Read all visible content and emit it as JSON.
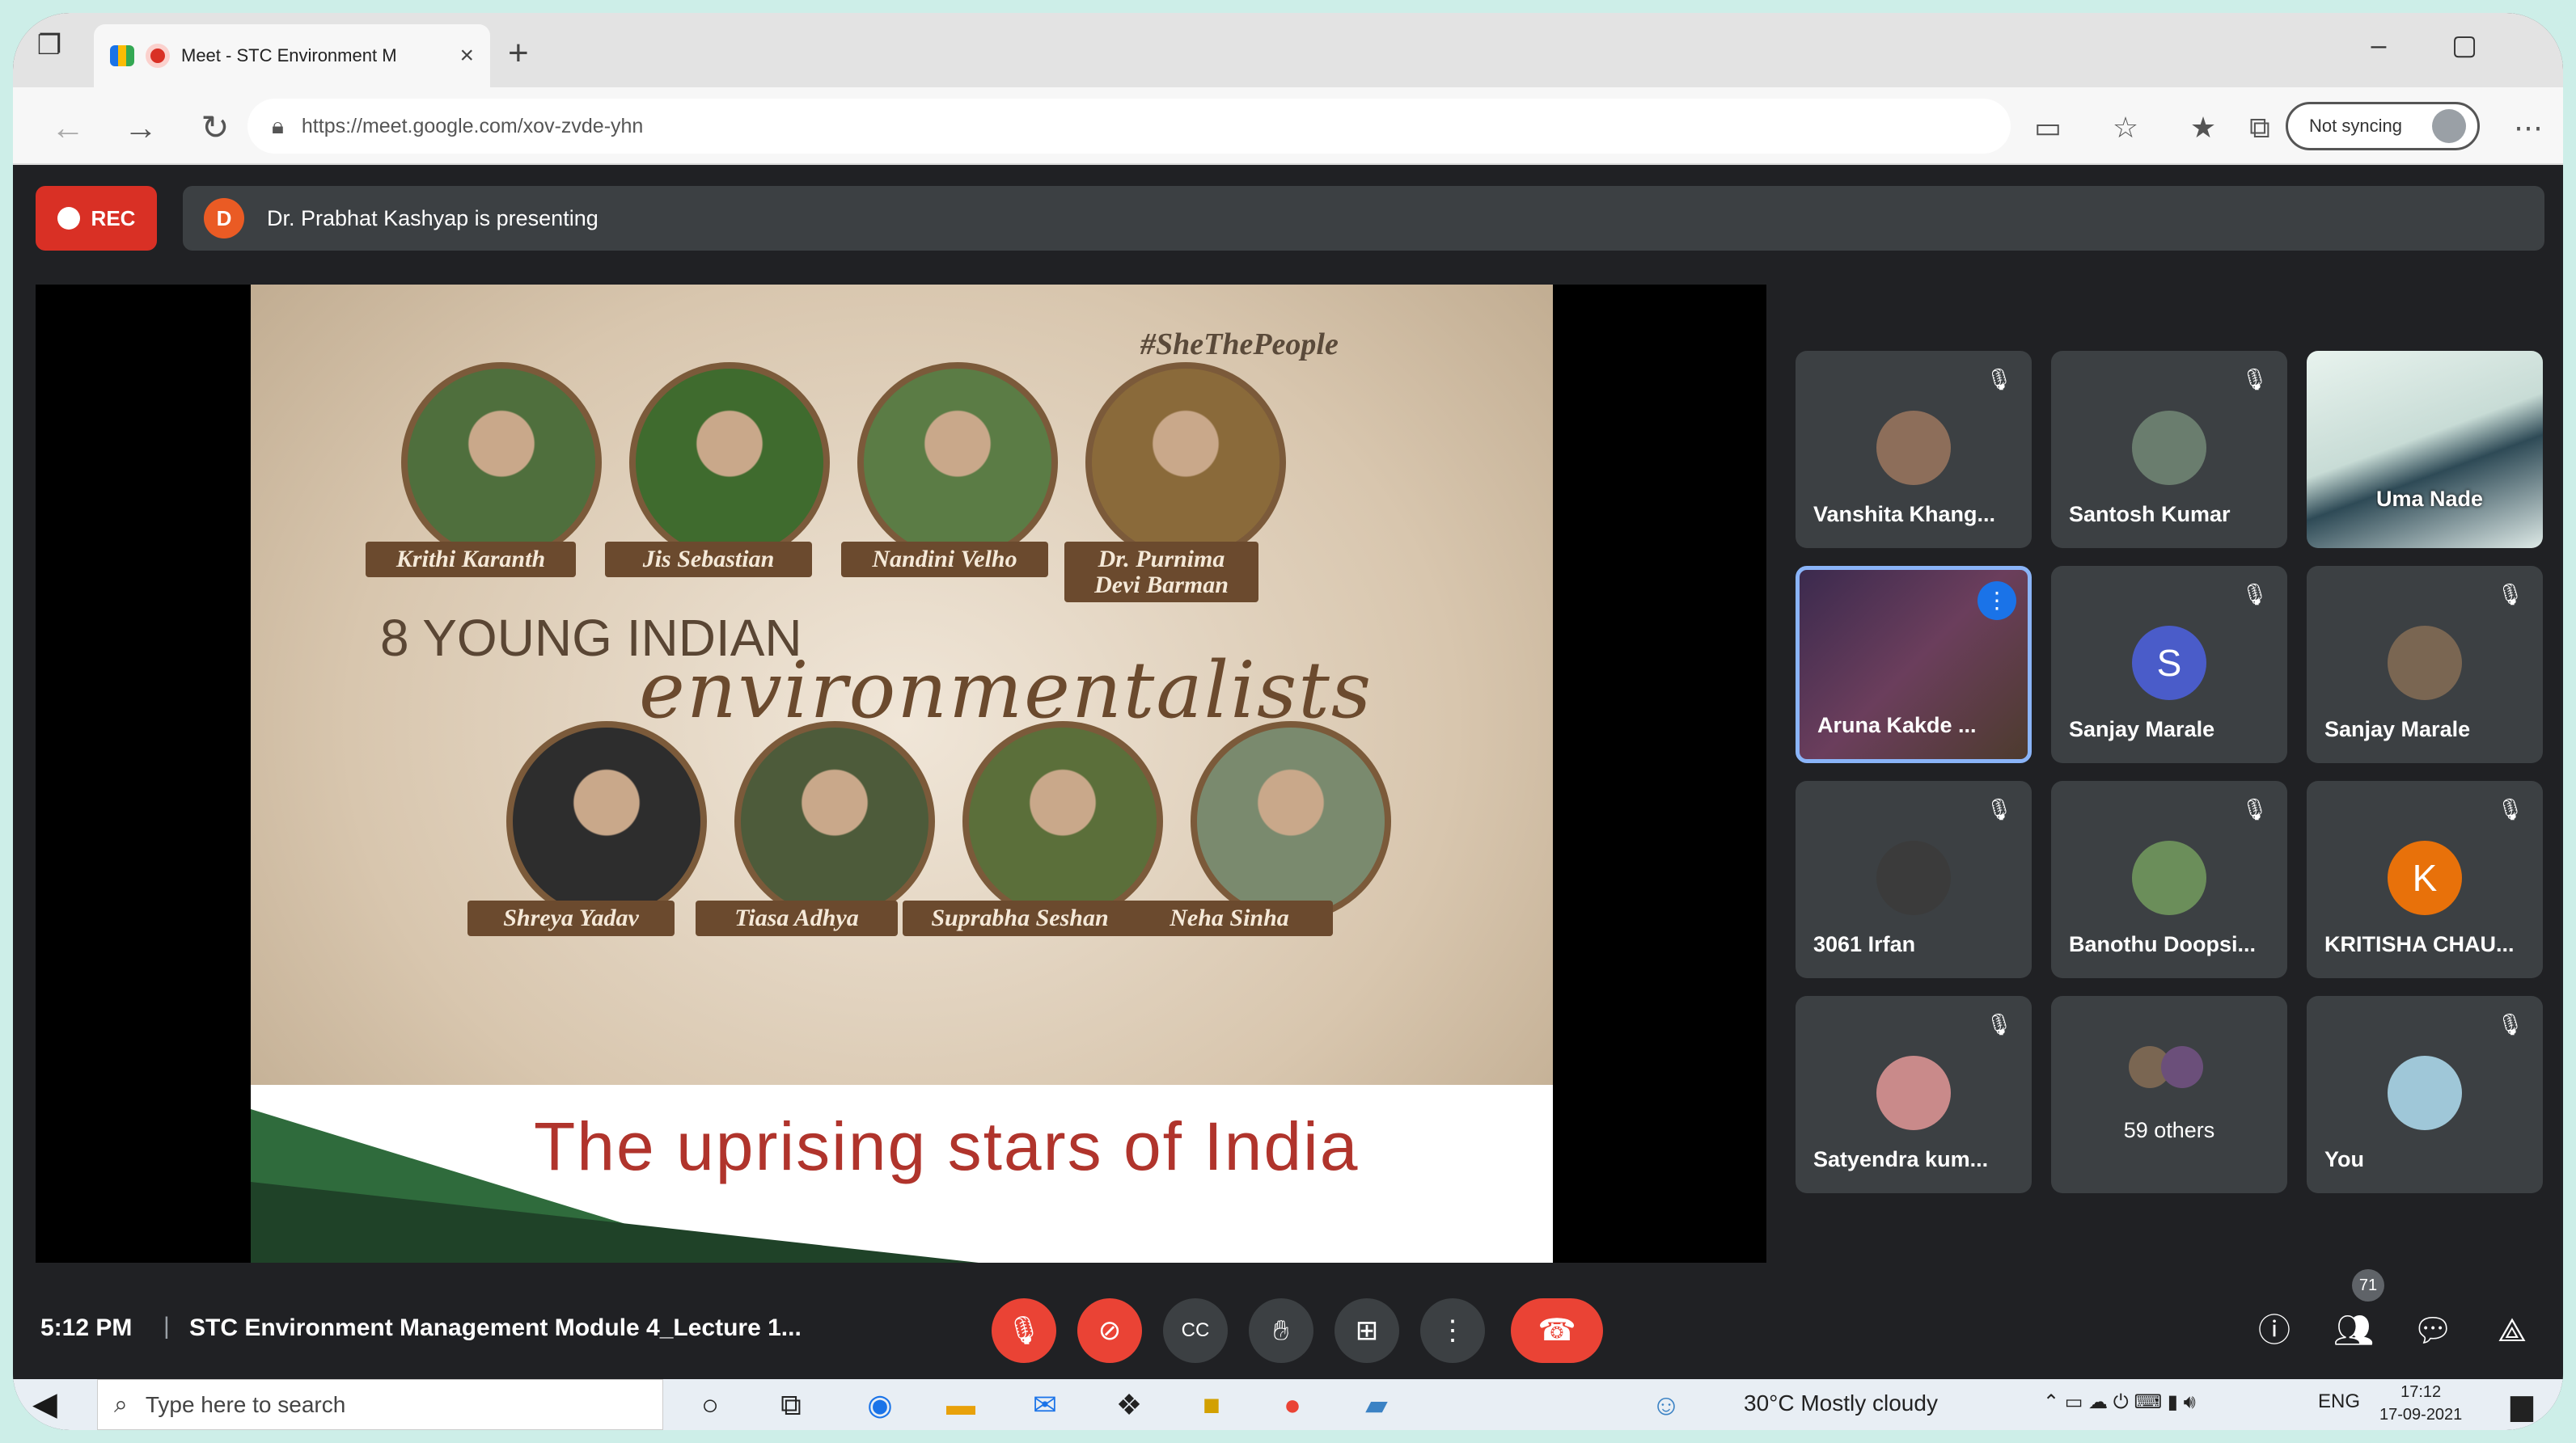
{
  "browser": {
    "tab_title": "Meet - STC Environment M",
    "url": "https://meet.google.com/xov-zvde-yhn",
    "sync_label": "Not syncing"
  },
  "meet": {
    "rec_label": "REC",
    "presenter_initial": "D",
    "presenting_text": "Dr. Prabhat Kashyap is presenting",
    "time": "5:12 PM",
    "separator": "|",
    "meeting_title": "STC Environment Management Module 4_Lecture 1...",
    "people_count": "71"
  },
  "slide": {
    "hashtag": "#SheThePeople",
    "heading": "8 YOUNG INDIAN",
    "script": "environmentalists",
    "caption": "The uprising stars of India",
    "people": [
      {
        "name": "Krithi Karanth",
        "photo_color": "#4f6f3d"
      },
      {
        "name": "Jis Sebastian",
        "photo_color": "#3f6b2e"
      },
      {
        "name": "Nandini Velho",
        "photo_color": "#5b7c45"
      },
      {
        "name": "Dr. Purnima Devi Barman",
        "photo_color": "#8a6a3a"
      },
      {
        "name": "Shreya Yadav",
        "photo_color": "#2d2d2d"
      },
      {
        "name": "Tiasa Adhya",
        "photo_color": "#4d5b3a"
      },
      {
        "name": "Suprabha Seshan",
        "photo_color": "#5b6f3a"
      },
      {
        "name": "Neha Sinha",
        "photo_color": "#7a8a6e"
      }
    ]
  },
  "participants": [
    {
      "name": "Vanshita Khang...",
      "initial": "",
      "avatar_color": "#8d6e5a"
    },
    {
      "name": "Santosh Kumar",
      "initial": "",
      "avatar_color": "#6a7d6e"
    },
    {
      "name": "Uma Nade",
      "initial": "",
      "avatar_color": ""
    },
    {
      "name": "Aruna Kakde ...",
      "initial": "",
      "avatar_color": ""
    },
    {
      "name": "Sanjay Marale",
      "initial": "S",
      "avatar_color": "#4a5cc9"
    },
    {
      "name": "Sanjay Marale",
      "initial": "",
      "avatar_color": "#7a6652"
    },
    {
      "name": "3061 Irfan",
      "initial": "",
      "avatar_color": "#3b3b3b"
    },
    {
      "name": "Banothu Doopsi...",
      "initial": "",
      "avatar_color": "#6b8e5a"
    },
    {
      "name": "KRITISHA CHAU...",
      "initial": "K",
      "avatar_color": "#e8710a"
    },
    {
      "name": "Satyendra kum...",
      "initial": "",
      "avatar_color": "#c98a8a"
    },
    {
      "name": "59 others",
      "initial": "",
      "avatar_color": ""
    },
    {
      "name": "You",
      "initial": "",
      "avatar_color": "#9fc7d8"
    }
  ],
  "taskbar": {
    "search_placeholder": "Type here to search",
    "weather": "30°C  Mostly cloudy",
    "language": "ENG",
    "clock_time": "17:12",
    "clock_date": "17-09-2021"
  },
  "colors": {
    "meet_background": "#202124",
    "tile_background": "#3c4043",
    "accent_red": "#ea4335",
    "accent_blue": "#8ab4f8"
  }
}
